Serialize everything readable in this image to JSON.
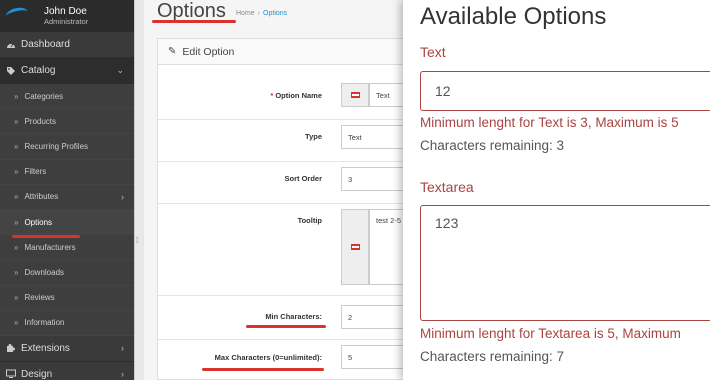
{
  "sidebar": {
    "user_name": "John Doe",
    "user_role": "Administrator",
    "top_items": [
      {
        "label": "Dashboard"
      },
      {
        "label": "Catalog"
      }
    ],
    "catalog_items": [
      {
        "label": "Categories"
      },
      {
        "label": "Products"
      },
      {
        "label": "Recurring Profiles"
      },
      {
        "label": "Filters"
      },
      {
        "label": "Attributes"
      },
      {
        "label": "Options"
      },
      {
        "label": "Manufacturers"
      },
      {
        "label": "Downloads"
      },
      {
        "label": "Reviews"
      },
      {
        "label": "Information"
      }
    ],
    "bottom_items": [
      {
        "label": "Extensions"
      },
      {
        "label": "Design"
      }
    ]
  },
  "header": {
    "title": "Options",
    "breadcrumb": [
      "Home",
      "Options"
    ]
  },
  "panel": {
    "heading": "Edit Option",
    "fields": {
      "option_name": {
        "label": "Option Name",
        "value": "Text"
      },
      "type": {
        "label": "Type",
        "value": "Text"
      },
      "sort_order": {
        "label": "Sort Order",
        "value": "3"
      },
      "tooltip": {
        "label": "Tooltip",
        "value": "test 2-5"
      },
      "min_chars": {
        "label": "Min Characters:",
        "value": "2"
      },
      "max_chars": {
        "label": "Max Characters (0=unlimited):",
        "value": "5"
      }
    }
  },
  "overlay": {
    "title": "Available Options",
    "text_label": "Text",
    "text_value": "12",
    "text_error": "Minimum lenght for Text is 3, Maximum is 5",
    "text_remaining": "Characters remaining: 3",
    "textarea_label": "Textarea",
    "textarea_value": "123",
    "textarea_error": "Minimum lenght for Textarea is 5, Maximum",
    "textarea_remaining": "Characters remaining: 7"
  },
  "colors": {
    "annotation_red": "#d9342b",
    "error_red": "#a94442",
    "link_blue": "#1e91cf"
  }
}
